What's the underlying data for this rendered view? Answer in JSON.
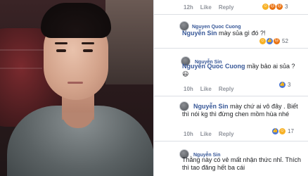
{
  "top_bar": {
    "time": "12h",
    "like": "Like",
    "reply": "Reply",
    "reaction_count": "3"
  },
  "comments": [
    {
      "author": "Nguyen Quoc Cuong",
      "mention": "Nguyễn Sin",
      "text": " mày sủa gì đó ?!",
      "reaction_count": "52"
    },
    {
      "author": "Nguyễn Sin",
      "mention": "Nguyen Quoc Cuong",
      "text": " mầy bảo ai sủa ? 😃",
      "time": "10h",
      "like": "Like",
      "reply": "Reply",
      "reaction_count": "3"
    },
    {
      "mention": "Nguyễn Sin",
      "text": " mày chứ ai vô đây . Biết thì nói kg thì đừng chen mồm hùa nhé",
      "time": "10h",
      "like": "Like",
      "reply": "Reply",
      "reaction_count": "17"
    },
    {
      "author": "Nguyễn Sin",
      "text": "Thằng này có vẻ mất nhận thức nhỉ. Thích thì tao đăng hết ba cái"
    }
  ]
}
